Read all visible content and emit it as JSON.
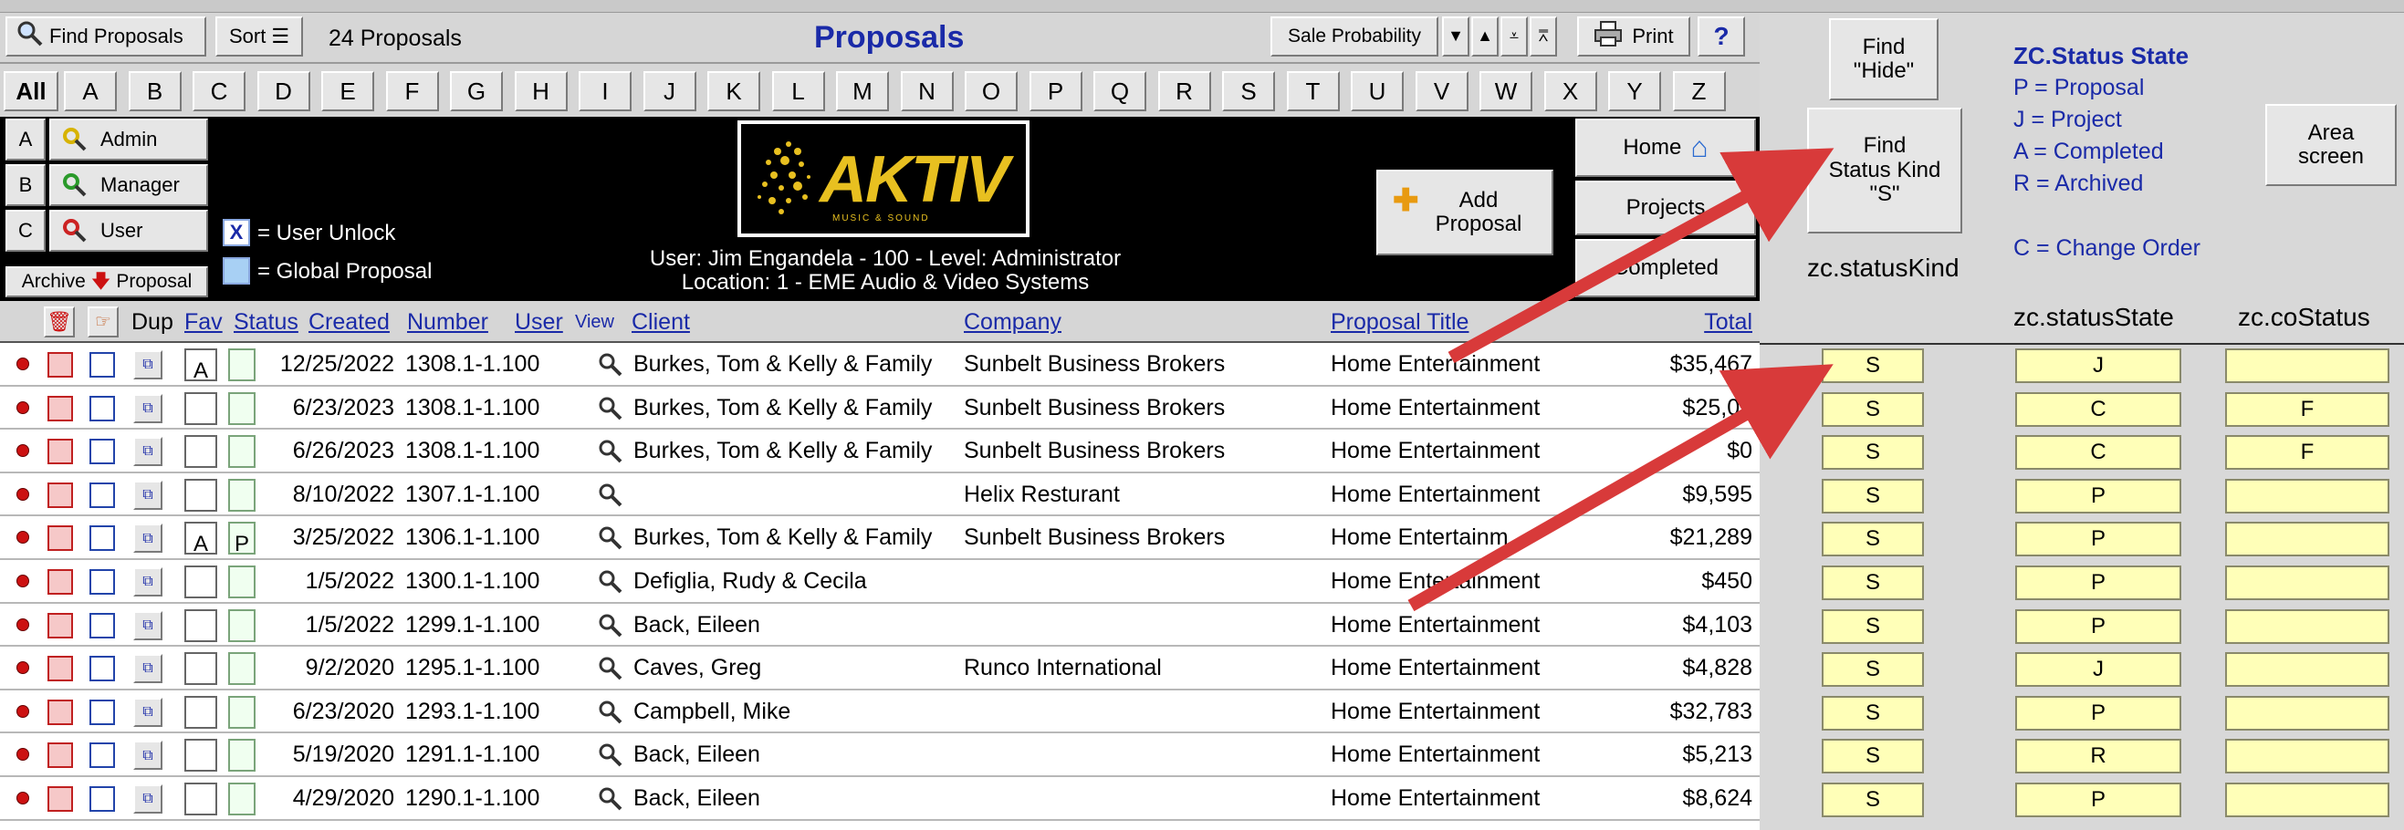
{
  "toolbar": {
    "find_label": "Find Proposals",
    "sort_label": "Sort",
    "count_label": "24 Proposals",
    "title": "Proposals",
    "sale_prob_label": "Sale Probability",
    "print_label": "Print",
    "help_label": "?"
  },
  "alphabet": [
    "All",
    "A",
    "B",
    "C",
    "D",
    "E",
    "F",
    "G",
    "H",
    "I",
    "J",
    "K",
    "L",
    "M",
    "N",
    "O",
    "P",
    "Q",
    "R",
    "S",
    "T",
    "U",
    "V",
    "W",
    "X",
    "Y",
    "Z"
  ],
  "side_buttons": [
    {
      "letter": "A",
      "label": "Admin",
      "color": "#d7b300"
    },
    {
      "letter": "B",
      "label": "Manager",
      "color": "#2a9a2a"
    },
    {
      "letter": "C",
      "label": "User",
      "color": "#cc2222"
    }
  ],
  "archive_label": "Archive",
  "archive_proposal_label": "Proposal",
  "legend": {
    "user_unlock": "= User Unlock",
    "user_unlock_mark": "X",
    "global": "= Global Proposal"
  },
  "logo_text": "AKTIV",
  "logo_sub": "MUSIC & SOUND",
  "user_line": "User: Jim Engandela - 100 - Level: Administrator",
  "location_line": "Location: 1 - EME Audio & Video Systems",
  "add_proposal": "Add\nProposal",
  "nav": {
    "home": "Home",
    "projects": "Projects",
    "completed": "Completed"
  },
  "headers": {
    "dup": "Dup",
    "fav": "Fav",
    "status": "Status",
    "created": "Created",
    "number": "Number",
    "user": "User",
    "view": "View",
    "client": "Client",
    "company": "Company",
    "title": "Proposal Title",
    "total": "Total"
  },
  "rows": [
    {
      "status": "A",
      "fav": "",
      "created": "12/25/2022",
      "number": "1308.1-1.100",
      "client": "Burkes, Tom & Kelly & Family",
      "company": "Sunbelt Business Brokers",
      "title": "Home Entertainment",
      "total": "$35,467",
      "kind": "S",
      "state": "J",
      "co": ""
    },
    {
      "status": "",
      "fav": "",
      "created": "6/23/2023",
      "number": "1308.1-1.100",
      "client": "Burkes, Tom & Kelly & Family",
      "company": "Sunbelt Business Brokers",
      "title": "Home Entertainment",
      "total": "$25,03",
      "kind": "S",
      "state": "C",
      "co": "F"
    },
    {
      "status": "",
      "fav": "",
      "created": "6/26/2023",
      "number": "1308.1-1.100",
      "client": "Burkes, Tom & Kelly & Family",
      "company": "Sunbelt Business Brokers",
      "title": "Home Entertainment",
      "total": "$0",
      "kind": "S",
      "state": "C",
      "co": "F"
    },
    {
      "status": "",
      "fav": "",
      "created": "8/10/2022",
      "number": "1307.1-1.100",
      "client": "",
      "company": "Helix Resturant",
      "title": "Home Entertainment",
      "total": "$9,595",
      "kind": "S",
      "state": "P",
      "co": ""
    },
    {
      "status": "A",
      "fav": "P",
      "created": "3/25/2022",
      "number": "1306.1-1.100",
      "client": "Burkes, Tom & Kelly & Family",
      "company": "Sunbelt Business Brokers",
      "title": "Home Entertainm",
      "total": "$21,289",
      "kind": "S",
      "state": "P",
      "co": ""
    },
    {
      "status": "",
      "fav": "",
      "created": "1/5/2022",
      "number": "1300.1-1.100",
      "client": "Defiglia, Rudy & Cecila",
      "company": "",
      "title": "Home Entertainment",
      "total": "$450",
      "kind": "S",
      "state": "P",
      "co": ""
    },
    {
      "status": "",
      "fav": "",
      "created": "1/5/2022",
      "number": "1299.1-1.100",
      "client": "Back, Eileen",
      "company": "",
      "title": "Home Entertainment",
      "total": "$4,103",
      "kind": "S",
      "state": "P",
      "co": ""
    },
    {
      "status": "",
      "fav": "",
      "created": "9/2/2020",
      "number": "1295.1-1.100",
      "client": "Caves, Greg",
      "company": "Runco International",
      "title": "Home Entertainment",
      "total": "$4,828",
      "kind": "S",
      "state": "J",
      "co": ""
    },
    {
      "status": "",
      "fav": "",
      "created": "6/23/2020",
      "number": "1293.1-1.100",
      "client": "Campbell, Mike",
      "company": "",
      "title": "Home Entertainment",
      "total": "$32,783",
      "kind": "S",
      "state": "P",
      "co": ""
    },
    {
      "status": "",
      "fav": "",
      "created": "5/19/2020",
      "number": "1291.1-1.100",
      "client": "Back, Eileen",
      "company": "",
      "title": "Home Entertainment",
      "total": "$5,213",
      "kind": "S",
      "state": "R",
      "co": ""
    },
    {
      "status": "",
      "fav": "",
      "created": "4/29/2020",
      "number": "1290.1-1.100",
      "client": "Back, Eileen",
      "company": "",
      "title": "Home Entertainment",
      "total": "$8,624",
      "kind": "S",
      "state": "P",
      "co": ""
    }
  ],
  "right": {
    "find_hide": "Find\n\"Hide\"",
    "find_status": "Find\nStatus Kind\n\"S\"",
    "area_screen": "Area\nscreen",
    "status_title": "ZC.Status State",
    "status_lines": [
      "P = Proposal",
      "J = Project",
      "A = Completed",
      "R = Archived"
    ],
    "change_order": "C = Change Order",
    "col_kind": "zc.statusKind",
    "col_state": "zc.statusState",
    "col_co": "zc.coStatus"
  },
  "colors": {
    "yellow_cell": "#ffffb8",
    "arrow": "#d83a3a",
    "link": "#1a2aa8"
  }
}
